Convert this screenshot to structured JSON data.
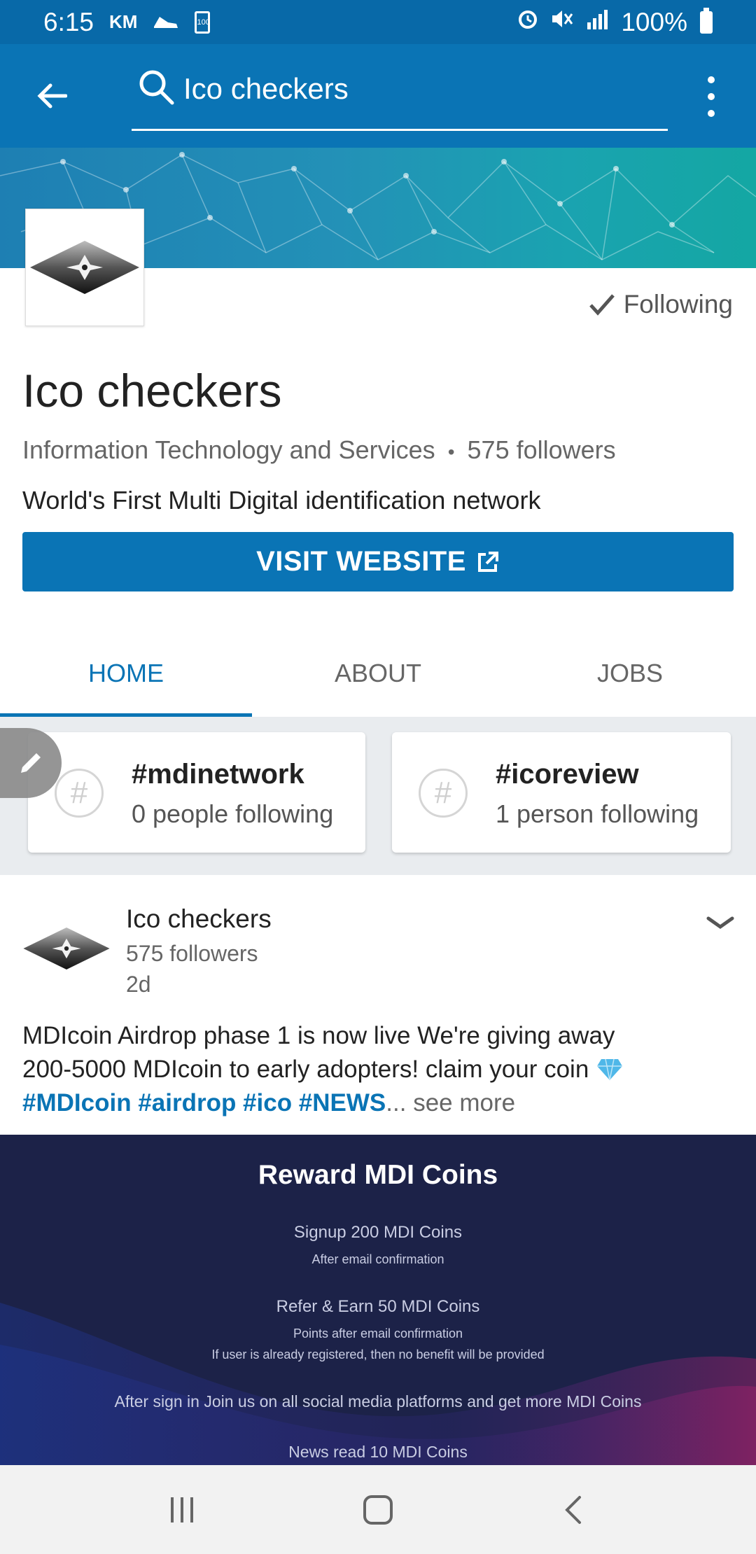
{
  "status_bar": {
    "time": "6:15",
    "left_glyphs": [
      "KM",
      "shoe-icon",
      "battery-100-icon"
    ],
    "battery_chip": "100",
    "battery_percent": "100%"
  },
  "app_bar": {
    "search_query": "Ico checkers"
  },
  "company": {
    "following_label": "Following",
    "name": "Ico checkers",
    "industry": "Information Technology and Services",
    "separator": "•",
    "followers": "575 followers",
    "tagline": "World's First Multi Digital identification network",
    "visit_label": "VISIT WEBSITE"
  },
  "tabs": [
    {
      "label": "HOME",
      "active": true
    },
    {
      "label": "ABOUT",
      "active": false
    },
    {
      "label": "JOBS",
      "active": false
    }
  ],
  "hashtags": [
    {
      "tag": "#mdinetwork",
      "following": "0 people following"
    },
    {
      "tag": "#icoreview",
      "following": "1 person following"
    }
  ],
  "post": {
    "author": "Ico checkers",
    "followers": "575 followers",
    "time": "2d",
    "text_line1": "MDIcoin Airdrop phase 1 is now live We're giving away",
    "text_line2": "200-5000 MDIcoin to early adopters! claim your coin",
    "hashtags": "#MDIcoin #airdrop #ico #NEWS",
    "ellipsis": "...",
    "see_more": "see more"
  },
  "post_image": {
    "title": "Reward MDI Coins",
    "lines": [
      "Signup 200 MDI Coins",
      "After email confirmation",
      "Refer & Earn 50 MDI Coins",
      "Points after email confirmation",
      "If user is already registered, then no benefit will be provided",
      "After sign in Join us on all social media platforms and get more MDI Coins",
      "News read 10 MDI Coins"
    ]
  },
  "colors": {
    "primary": "#0a74b5",
    "status_bar": "#0869a8",
    "image_bg": "#1c2248"
  }
}
